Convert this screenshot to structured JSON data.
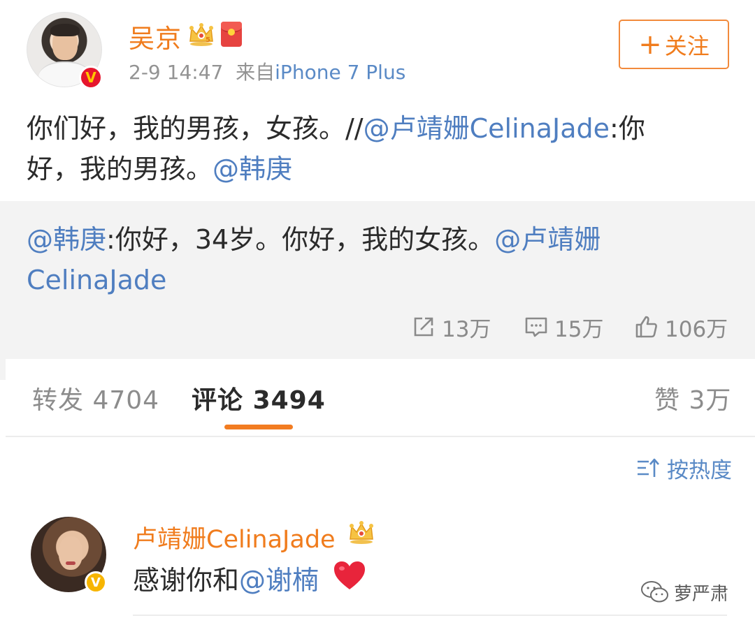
{
  "post": {
    "author": "吴京",
    "date": "2-9 14:47",
    "source_prefix": "来自",
    "source": "iPhone 7 Plus",
    "follow_plus": "+",
    "follow_label": "关注",
    "verified_mark": "V",
    "body": {
      "line1_text": "你们好，我的男孩，女孩。//",
      "line1_mention": "@卢靖姗CelinaJade",
      "line1_tail": ":你",
      "line2_text": "好，我的男孩。",
      "line2_mention": "@韩庚"
    }
  },
  "repost": {
    "mention1": "@韩庚",
    "text": ":你好，34岁。你好，我的女孩。",
    "mention2_line1": "@卢靖姗",
    "mention2_line2": "CelinaJade",
    "reposts": "13万",
    "comments": "15万",
    "likes": "106万"
  },
  "tabs": {
    "repost_label": "转发",
    "repost_count": "4704",
    "comment_label": "评论",
    "comment_count": "3494",
    "like_label": "赞",
    "like_count": "3万"
  },
  "sort": {
    "label": "按热度"
  },
  "comment": {
    "user": "卢靖姗CelinaJade",
    "text": "感谢你和",
    "mention": "@谢楠",
    "verified_mark": "V"
  },
  "watermark": {
    "text": "萝严肃"
  },
  "colors": {
    "orange": "#f07c1d",
    "link_blue": "#4f7ec0",
    "repost_bg": "#f3f3f3",
    "grey_text": "#939393"
  }
}
